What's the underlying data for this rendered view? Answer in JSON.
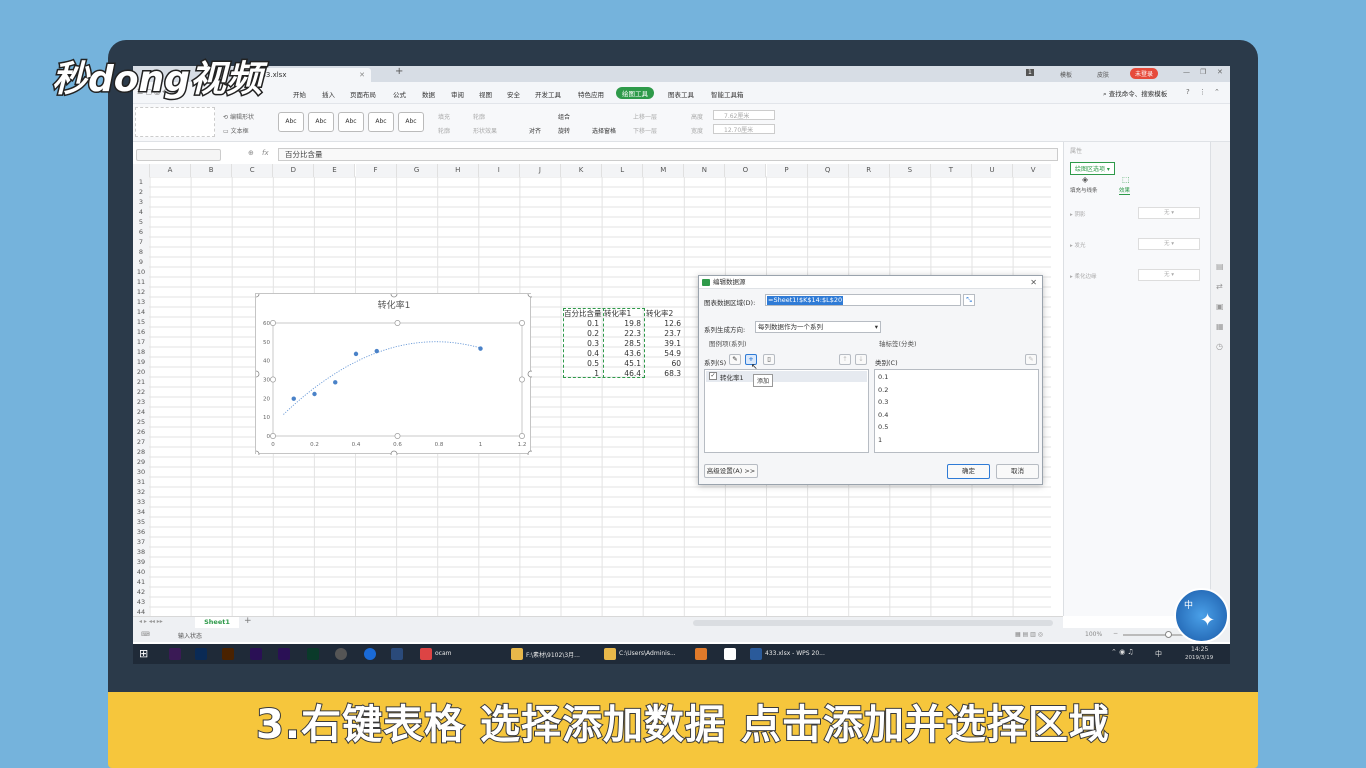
{
  "branding": {
    "logo": "秒dong视频"
  },
  "caption": "3.右键表格 选择添加数据 点击添加并选择区域",
  "colors": {
    "accent": "#2e9a4a",
    "caption_bg": "#f6c63c",
    "chart_point": "#4a82c8",
    "selection": "#2f7bd6"
  },
  "window": {
    "tab_title": "433.xlsx",
    "top_right": {
      "count_badge": "1",
      "template": "模板",
      "skin": "皮肤",
      "login": "未登录"
    }
  },
  "menu": {
    "items": [
      "开始",
      "插入",
      "页面布局",
      "公式",
      "数据",
      "审阅",
      "视图",
      "安全",
      "开发工具",
      "特色应用",
      "绘图工具",
      "图表工具",
      "智能工具箱"
    ],
    "active": "绘图工具",
    "search": "查找命令、搜索模板"
  },
  "toolbar": {
    "edit_shape": "编辑形状",
    "textbox": "文本框",
    "abc": "Abc",
    "fill": "填充",
    "outline": "轮廓",
    "shape_effect": "形状效果",
    "shape_outline": "轮廓",
    "align": "对齐",
    "group": "组合",
    "rotate": "旋转",
    "select_pane": "选择窗格",
    "up_one": "上移一层",
    "down_one": "下移一层",
    "height_label": "高度",
    "height_val": "7.62厘米",
    "width_label": "宽度",
    "width_val": "12.70厘米"
  },
  "formula": {
    "fx": "fx",
    "content": "百分比含量"
  },
  "grid": {
    "columns": [
      "A",
      "B",
      "C",
      "D",
      "E",
      "F",
      "G",
      "H",
      "I",
      "J",
      "K",
      "L",
      "M",
      "N",
      "O",
      "P",
      "Q",
      "R",
      "S",
      "T",
      "U",
      "V"
    ],
    "rows": [
      "1",
      "2",
      "3",
      "4",
      "5",
      "6",
      "7",
      "8",
      "9",
      "10",
      "11",
      "12",
      "13",
      "14",
      "15",
      "16",
      "17",
      "18",
      "19",
      "20",
      "21",
      "22",
      "23",
      "24",
      "25",
      "26",
      "27",
      "28",
      "29",
      "30",
      "31",
      "32",
      "33",
      "34",
      "35",
      "36",
      "37",
      "38",
      "39",
      "40",
      "41",
      "42",
      "43",
      "44"
    ]
  },
  "table": {
    "headers": [
      "百分比含量",
      "转化率1",
      "转化率2"
    ],
    "rows": [
      [
        "0.1",
        "19.8",
        "12.6"
      ],
      [
        "0.2",
        "22.3",
        "23.7"
      ],
      [
        "0.3",
        "28.5",
        "39.1"
      ],
      [
        "0.4",
        "43.6",
        "54.9"
      ],
      [
        "0.5",
        "45.1",
        "60"
      ],
      [
        "1",
        "46.4",
        "68.3"
      ]
    ]
  },
  "chart_data": {
    "type": "scatter",
    "title": "转化率1",
    "x": [
      0.1,
      0.2,
      0.3,
      0.4,
      0.5,
      1
    ],
    "series": [
      {
        "values": [
          19.8,
          22.3,
          28.5,
          43.6,
          45.1,
          46.4
        ]
      }
    ],
    "xlim": [
      0,
      1.2
    ],
    "ylim": [
      0,
      60
    ],
    "xticks": [
      "0",
      "0.2",
      "0.4",
      "0.6",
      "0.8",
      "1",
      "1.2"
    ],
    "yticks": [
      "0",
      "10",
      "20",
      "30",
      "40",
      "50",
      "60"
    ],
    "trendline": "polynomial (dotted)",
    "grid": false
  },
  "dialog": {
    "title": "编辑数据源",
    "range_label": "图表数据区域(D):",
    "range_value": "=Sheet1!$K$14:$L$20",
    "direction_label": "系列生成方向:",
    "direction_value": "每列数据作为一个系列",
    "legend_section": "图例项(系列)",
    "axis_section": "轴标签(分类)",
    "series_label": "系列(S)",
    "category_label": "类别(C)",
    "series_items": [
      "转化率1"
    ],
    "tooltip": "添加",
    "categories": [
      "0.1",
      "0.2",
      "0.3",
      "0.4",
      "0.5",
      "1"
    ],
    "advanced": "高级设置(A) >>",
    "ok": "确定",
    "cancel": "取消"
  },
  "side_panel": {
    "header": "属性",
    "dropdown": "绘图区选项",
    "tab_fill": "填充与线条",
    "tab_effect": "效果",
    "rows": [
      {
        "label": "阴影",
        "value": "无"
      },
      {
        "label": "发光",
        "value": "无"
      },
      {
        "label": "柔化边缘",
        "value": "无"
      }
    ]
  },
  "sheet": {
    "tab": "Sheet1",
    "status": "输入状态",
    "zoom": "100%"
  },
  "taskbar": {
    "items": [
      "ocam",
      "F:\\素材\\9102\\3月...",
      "C:\\Users\\Adminis...",
      "433.xlsx - WPS 20..."
    ],
    "ime": "中",
    "time": "14:25",
    "date": "2019/3/19"
  }
}
